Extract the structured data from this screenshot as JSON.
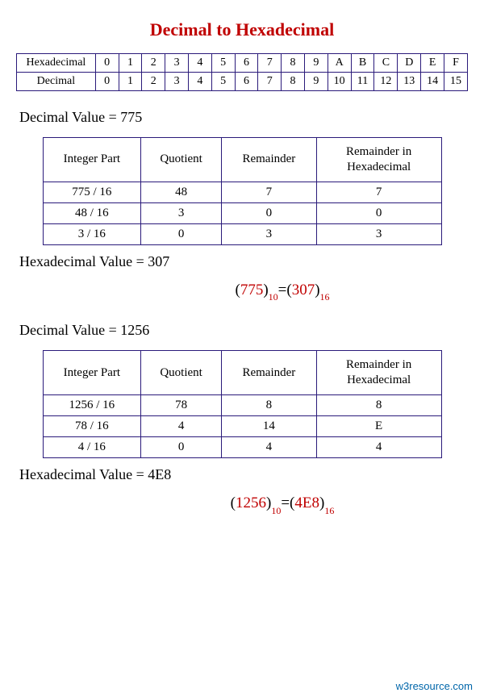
{
  "title": "Decimal to Hexadecimal",
  "map": {
    "row_hex_label": "Hexadecimal",
    "row_dec_label": "Decimal",
    "hex": [
      "0",
      "1",
      "2",
      "3",
      "4",
      "5",
      "6",
      "7",
      "8",
      "9",
      "A",
      "B",
      "C",
      "D",
      "E",
      "F"
    ],
    "dec": [
      "0",
      "1",
      "2",
      "3",
      "4",
      "5",
      "6",
      "7",
      "8",
      "9",
      "10",
      "11",
      "12",
      "13",
      "14",
      "15"
    ]
  },
  "labels": {
    "decimal_value": "Decimal Value  =  ",
    "hex_value": "Hexadecimal Value  =  "
  },
  "headers": {
    "integer_part": "Integer Part",
    "quotient": "Quotient",
    "remainder": "Remainder",
    "remainder_hex": "Remainder  in Hexadecimal"
  },
  "example1": {
    "decimal_value": "775",
    "hex_value": "307",
    "rows": [
      {
        "int": "775 / 16",
        "q": "48",
        "r": "7",
        "rh": "7"
      },
      {
        "int": "48 / 16",
        "q": "3",
        "r": "0",
        "rh": "0"
      },
      {
        "int": "3 / 16",
        "q": "0",
        "r": "3",
        "rh": "3"
      }
    ],
    "eq": {
      "lhs": "775",
      "lhs_base": "10",
      "rhs": "307",
      "rhs_base": "16"
    }
  },
  "example2": {
    "decimal_value": "1256",
    "hex_value": "4E8",
    "rows": [
      {
        "int": "1256 / 16",
        "q": "78",
        "r": "8",
        "rh": "8"
      },
      {
        "int": "78 / 16",
        "q": "4",
        "r": "14",
        "rh": "E"
      },
      {
        "int": "4 / 16",
        "q": "0",
        "r": "4",
        "rh": "4"
      }
    ],
    "eq": {
      "lhs": "1256",
      "lhs_base": "10",
      "rhs": "4E8",
      "rhs_base": "16"
    }
  },
  "footer": "w3resource.com",
  "chart_data": {
    "type": "table",
    "title": "Decimal to Hexadecimal conversion examples",
    "mapping": {
      "hexadecimal": [
        "0",
        "1",
        "2",
        "3",
        "4",
        "5",
        "6",
        "7",
        "8",
        "9",
        "A",
        "B",
        "C",
        "D",
        "E",
        "F"
      ],
      "decimal": [
        0,
        1,
        2,
        3,
        4,
        5,
        6,
        7,
        8,
        9,
        10,
        11,
        12,
        13,
        14,
        15
      ]
    },
    "examples": [
      {
        "decimal": 775,
        "hex": "307",
        "steps": [
          {
            "dividend": 775,
            "divisor": 16,
            "quotient": 48,
            "remainder": 7,
            "remainder_hex": "7"
          },
          {
            "dividend": 48,
            "divisor": 16,
            "quotient": 3,
            "remainder": 0,
            "remainder_hex": "0"
          },
          {
            "dividend": 3,
            "divisor": 16,
            "quotient": 0,
            "remainder": 3,
            "remainder_hex": "3"
          }
        ]
      },
      {
        "decimal": 1256,
        "hex": "4E8",
        "steps": [
          {
            "dividend": 1256,
            "divisor": 16,
            "quotient": 78,
            "remainder": 8,
            "remainder_hex": "8"
          },
          {
            "dividend": 78,
            "divisor": 16,
            "quotient": 4,
            "remainder": 14,
            "remainder_hex": "E"
          },
          {
            "dividend": 4,
            "divisor": 16,
            "quotient": 0,
            "remainder": 4,
            "remainder_hex": "4"
          }
        ]
      }
    ]
  }
}
